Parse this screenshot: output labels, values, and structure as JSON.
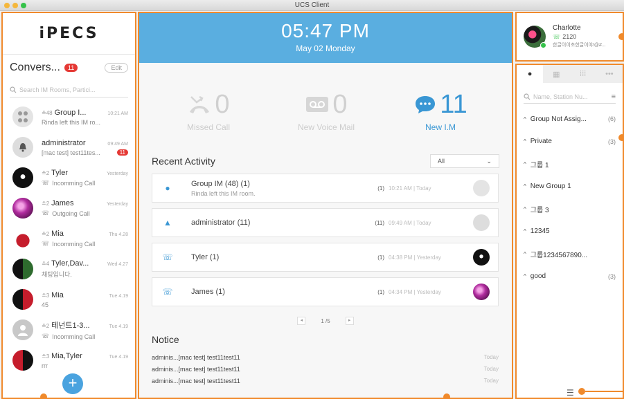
{
  "window": {
    "title": "UCS Client"
  },
  "left": {
    "logo": "iPECS",
    "conversations_title": "Convers...",
    "conversations_badge": "11",
    "edit_label": "Edit",
    "search_placeholder": "Search IM Rooms, Partici...",
    "items": [
      {
        "count": "48",
        "name": "Group I...",
        "time": "10:21 AM",
        "preview": "Rinda left this IM ro...",
        "kind": "group"
      },
      {
        "count": "",
        "name": "administrator",
        "time": "09:49 AM",
        "preview": "[mac test] test11tes...",
        "badge": "11",
        "kind": "admin"
      },
      {
        "count": "2",
        "name": "Tyler",
        "time": "Yesterday",
        "preview": "Incomming Call",
        "kind": "call-in"
      },
      {
        "count": "2",
        "name": "James",
        "time": "Yesterday",
        "preview": "Outgoing Call",
        "kind": "call-out"
      },
      {
        "count": "2",
        "name": "Mia",
        "time": "Thu 4.28",
        "preview": "Incomming Call",
        "kind": "call-in"
      },
      {
        "count": "4",
        "name": "Tyler,Dav...",
        "time": "Wed 4.27",
        "preview": "채팅입니다.",
        "kind": "chat"
      },
      {
        "count": "3",
        "name": "Mia",
        "time": "Tue 4.19",
        "preview": "45",
        "kind": "chat"
      },
      {
        "count": "2",
        "name": "테넌트1-3...",
        "time": "Tue 4.19",
        "preview": "Incomming Call",
        "kind": "call-in"
      },
      {
        "count": "3",
        "name": "Mia,Tyler",
        "time": "Tue 4.19",
        "preview": "rrr",
        "kind": "chat"
      }
    ]
  },
  "center": {
    "time": "05:47 PM",
    "date": "May 02 Monday",
    "stats": [
      {
        "value": "0",
        "label": "Missed Call"
      },
      {
        "value": "0",
        "label": "New Voice Mail"
      },
      {
        "value": "11",
        "label": "New I.M"
      }
    ],
    "recent_activity_title": "Recent Activity",
    "filter_value": "All",
    "activities": [
      {
        "name": "Group IM (48) (1)",
        "sub": "Rinda left this IM room.",
        "count": "(1)",
        "time": "10:21 AM  |  Today",
        "icon": "chat-icon"
      },
      {
        "name": "administrator (11)",
        "sub": "",
        "count": "(11)",
        "time": "09:49 AM  |  Today",
        "icon": "bell-icon"
      },
      {
        "name": "Tyler (1)",
        "sub": "",
        "count": "(1)",
        "time": "04:38 PM  |  Yesterday",
        "icon": "incoming-call-icon"
      },
      {
        "name": "James (1)",
        "sub": "",
        "count": "(1)",
        "time": "04:34 PM  |  Yesterday",
        "icon": "outgoing-call-icon"
      }
    ],
    "pager": "1 /5",
    "notice_title": "Notice",
    "notices": [
      {
        "text": "adminis...[mac test] test11test11",
        "time": "Today"
      },
      {
        "text": "adminis...[mac test] test11test11",
        "time": "Today"
      },
      {
        "text": "adminis...[mac test] test11test11",
        "time": "Today"
      }
    ]
  },
  "profile": {
    "name": "Charlotte",
    "extension": "2120",
    "status": "한글이이초한글이야!@#..."
  },
  "right": {
    "search_placeholder": "Name, Station Nu...",
    "groups": [
      {
        "name": "Group Not Assig...",
        "count": "(6)"
      },
      {
        "name": "Private",
        "count": "(3)"
      },
      {
        "name": "그룹 1",
        "count": ""
      },
      {
        "name": "New Group 1",
        "count": ""
      },
      {
        "name": "그룹 3",
        "count": ""
      },
      {
        "name": "12345",
        "count": ""
      },
      {
        "name": "그룹1234567890...",
        "count": ""
      },
      {
        "name": "good",
        "count": "(3)"
      }
    ]
  },
  "colors": {
    "accent": "#f08a2c",
    "header_blue": "#5aaee0",
    "link_blue": "#3a97d4",
    "badge_red": "#e53935"
  }
}
